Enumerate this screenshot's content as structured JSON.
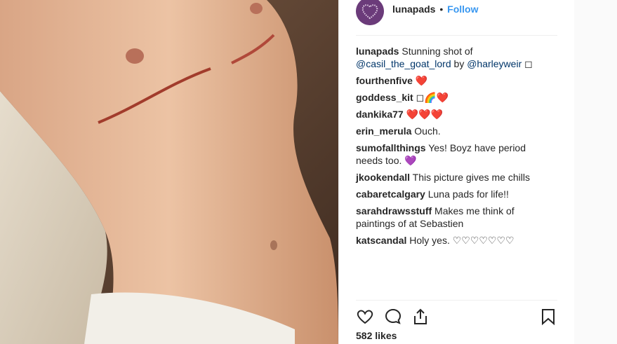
{
  "post": {
    "username": "lunapads",
    "separator": "•",
    "follow_label": "Follow",
    "likes": "582 likes",
    "photo_icon": "shirtless-person-photo",
    "avatar_icon": "heart-logo-icon"
  },
  "comments": [
    {
      "user": "lunapads",
      "text": " Stunning shot of ",
      "mention1": "@casil_the_goat_lord",
      "mid": " by ",
      "mention2": "@harleyweir",
      "tail": " ◻"
    },
    {
      "user": "fourthenfive",
      "text": " ❤️"
    },
    {
      "user": "goddess_kit",
      "text": " ◻🌈❤️"
    },
    {
      "user": "dankika77",
      "text": " ❤️❤️❤️"
    },
    {
      "user": "erin_merula",
      "text": " Ouch."
    },
    {
      "user": "sumofallthings",
      "text": " Yes! Boyz have period needs too. 💜"
    },
    {
      "user": "jkookendall",
      "text": " This picture gives me chills"
    },
    {
      "user": "cabaretcalgary",
      "text": " Luna pads for life!!"
    },
    {
      "user": "sarahdrawsstuff",
      "text": " Makes me think of paintings of at Sebastien"
    },
    {
      "user": "katscandal",
      "text": " Holy yes. ♡♡♡♡♡♡♡"
    }
  ],
  "colors": {
    "follow": "#3897f0",
    "avatar": "#6b3b7a",
    "heart": "#ed2b2b"
  }
}
